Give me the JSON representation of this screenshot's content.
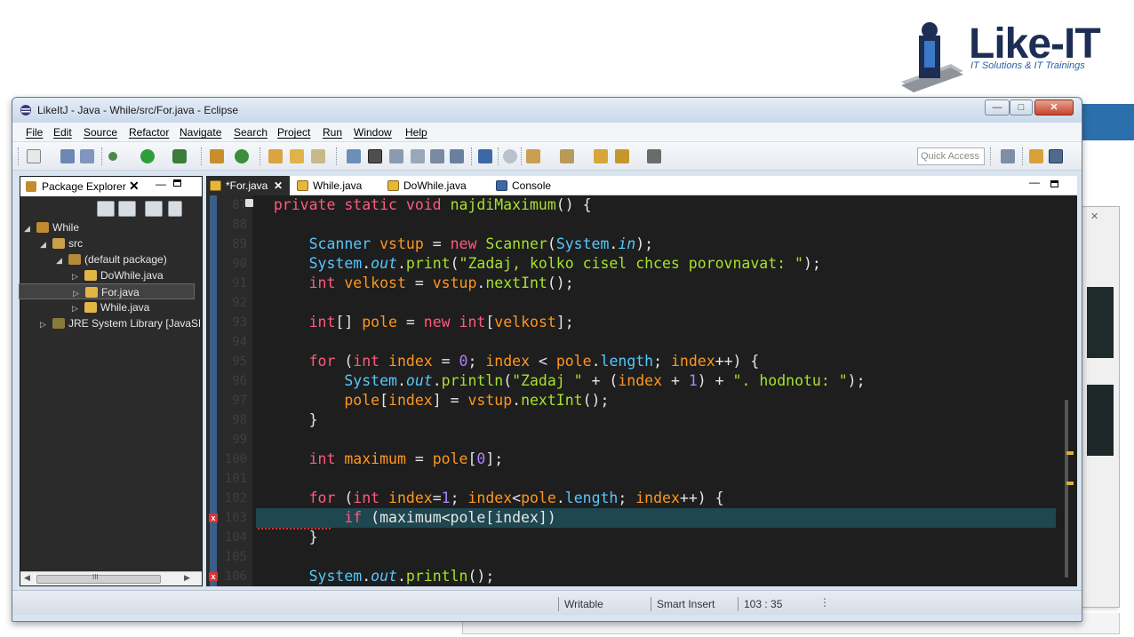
{
  "window": {
    "title": "LikeItJ - Java - While/src/For.java - Eclipse",
    "min_glyph": "—",
    "max_glyph": "□",
    "close_glyph": "✕"
  },
  "logo": {
    "text": "Like-IT",
    "tagline": "IT Solutions & IT Trainings"
  },
  "menu": [
    "File",
    "Edit",
    "Source",
    "Refactor",
    "Navigate",
    "Search",
    "Project",
    "Run",
    "Window",
    "Help"
  ],
  "toolbar": {
    "quick_access_placeholder": "Quick Access"
  },
  "package_explorer": {
    "title": "Package Explorer",
    "close": "✕",
    "minimize": "—",
    "tree": [
      {
        "label": "While",
        "toggle": "◢",
        "icon": "project-icon"
      },
      {
        "label": "src",
        "toggle": "◢",
        "icon": "source-folder-icon"
      },
      {
        "label": "(default package)",
        "toggle": "◢",
        "icon": "package-icon"
      },
      {
        "label": "DoWhile.java",
        "toggle": "▷",
        "icon": "java-file-icon"
      },
      {
        "label": "For.java",
        "toggle": "▷",
        "icon": "java-file-icon"
      },
      {
        "label": "While.java",
        "toggle": "▷",
        "icon": "java-file-icon"
      },
      {
        "label": "JRE System Library [JavaSE",
        "toggle": "▷",
        "icon": "library-icon"
      }
    ],
    "scroll_left": "◀",
    "scroll_right": "▶",
    "scroll_grip": "III"
  },
  "editor": {
    "tabs": [
      {
        "label": "*For.java",
        "close": "✕",
        "active": true
      },
      {
        "label": "While.java",
        "active": false
      },
      {
        "label": "DoWhile.java",
        "active": false
      },
      {
        "label": "Console",
        "active": false
      }
    ],
    "minimize": "—",
    "line_numbers": [
      "87",
      "88",
      "89",
      "90",
      "91",
      "92",
      "93",
      "94",
      "95",
      "96",
      "97",
      "98",
      "99",
      "100",
      "101",
      "102",
      "103",
      "104",
      "105",
      "106"
    ],
    "error_marker": "x"
  },
  "status": {
    "writable": "Writable",
    "insert_mode": "Smart Insert",
    "position": "103 : 35",
    "more": "⋮"
  },
  "colors": {
    "editor_background": "#1e1e1e",
    "current_line": "#1f4750",
    "keyword": "#ff5a7e",
    "type": "#54c8ff",
    "method": "#a6e22e",
    "error": "#dd3333"
  }
}
